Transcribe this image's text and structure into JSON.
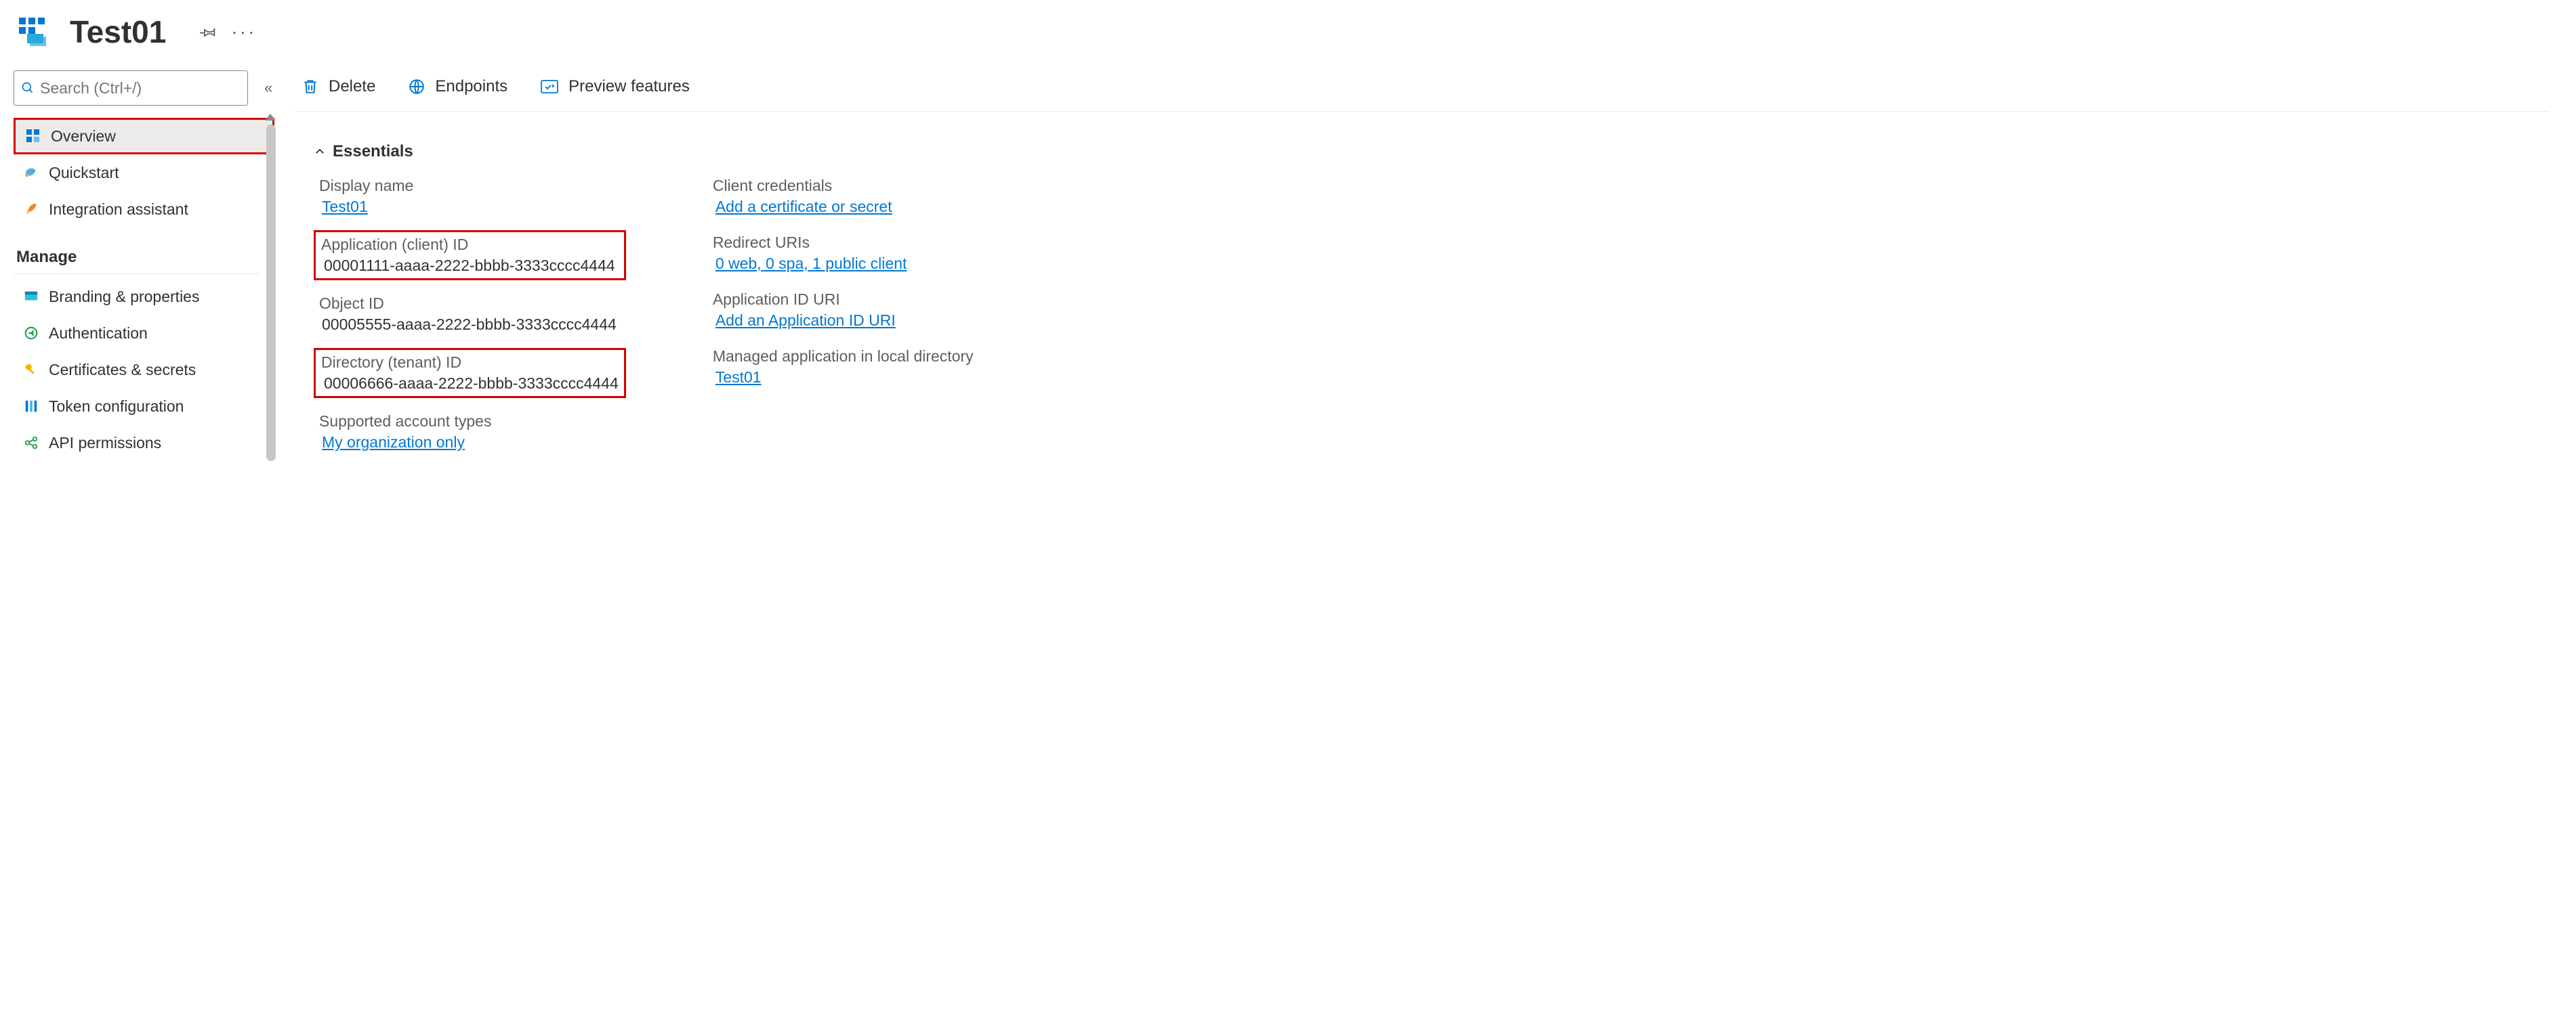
{
  "header": {
    "title": "Test01"
  },
  "sidebar": {
    "search_placeholder": "Search (Ctrl+/)",
    "items_top": [
      {
        "label": "Overview",
        "icon": "overview",
        "active": true
      },
      {
        "label": "Quickstart",
        "icon": "quickstart",
        "active": false
      },
      {
        "label": "Integration assistant",
        "icon": "rocket",
        "active": false
      }
    ],
    "section_label": "Manage",
    "items_manage": [
      {
        "label": "Branding & properties",
        "icon": "branding"
      },
      {
        "label": "Authentication",
        "icon": "auth"
      },
      {
        "label": "Certificates & secrets",
        "icon": "key"
      },
      {
        "label": "Token configuration",
        "icon": "token"
      },
      {
        "label": "API permissions",
        "icon": "api"
      }
    ]
  },
  "toolbar": {
    "delete": "Delete",
    "endpoints": "Endpoints",
    "preview": "Preview features"
  },
  "essentials": {
    "heading": "Essentials",
    "left": {
      "display_name": {
        "label": "Display name",
        "value": "Test01"
      },
      "app_client_id": {
        "label": "Application (client) ID",
        "value": "00001111-aaaa-2222-bbbb-3333cccc4444"
      },
      "object_id": {
        "label": "Object ID",
        "value": "00005555-aaaa-2222-bbbb-3333cccc4444"
      },
      "directory_id": {
        "label": "Directory (tenant) ID",
        "value": "00006666-aaaa-2222-bbbb-3333cccc4444"
      },
      "account_types": {
        "label": "Supported account types",
        "value": "My organization only"
      }
    },
    "right": {
      "client_creds": {
        "label": "Client credentials",
        "value": "Add a certificate or secret"
      },
      "redirect_uris": {
        "label": "Redirect URIs",
        "value": "0 web, 0 spa, 1 public client"
      },
      "app_id_uri": {
        "label": "Application ID URI",
        "value": "Add an Application ID URI"
      },
      "managed_app": {
        "label": "Managed application in local directory",
        "value": "Test01"
      }
    }
  }
}
